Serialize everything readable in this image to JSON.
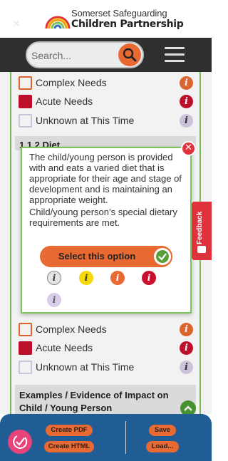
{
  "header": {
    "logo_line1": "Somerset Safeguarding",
    "logo_line2": "Children Partnership"
  },
  "nav": {
    "search_placeholder": "Search..."
  },
  "options_top": [
    {
      "label": "Complex Needs",
      "level": "orange"
    },
    {
      "label": "Acute Needs",
      "level": "red",
      "checked": true
    },
    {
      "label": "Unknown at This Time",
      "level": "lilac"
    }
  ],
  "section": {
    "title_partial": "1.1.2 Diet"
  },
  "options_bottom": [
    {
      "label": "Complex Needs",
      "level": "orange"
    },
    {
      "label": "Acute Needs",
      "level": "red",
      "checked": true
    },
    {
      "label": "Unknown at This Time",
      "level": "lilac"
    }
  ],
  "examples": {
    "title": "Examples / Evidence of Impact on Child / Young Person"
  },
  "modal": {
    "paragraph1": "The child/young person is provided with and eats a varied diet that is appropriate for their age and stage of development and is maintaining an appropriate weight.",
    "paragraph2": "Child/young person’s special dietary requirements are met.",
    "select_label": "Select this option",
    "info_icons": [
      "grey",
      "yellow",
      "orange",
      "red",
      "lilac"
    ],
    "info_glyph": "i"
  },
  "feedback": {
    "label": "Feedback"
  },
  "toolbar": {
    "create_pdf": "Create PDF",
    "create_html": "Create HTML",
    "save": "Save",
    "load": "Load..."
  },
  "colors": {
    "accent_orange": "#e86a32",
    "accent_green": "#7cc35a",
    "close_red": "#e0323c",
    "toolbar_blue": "#1f5d94"
  }
}
